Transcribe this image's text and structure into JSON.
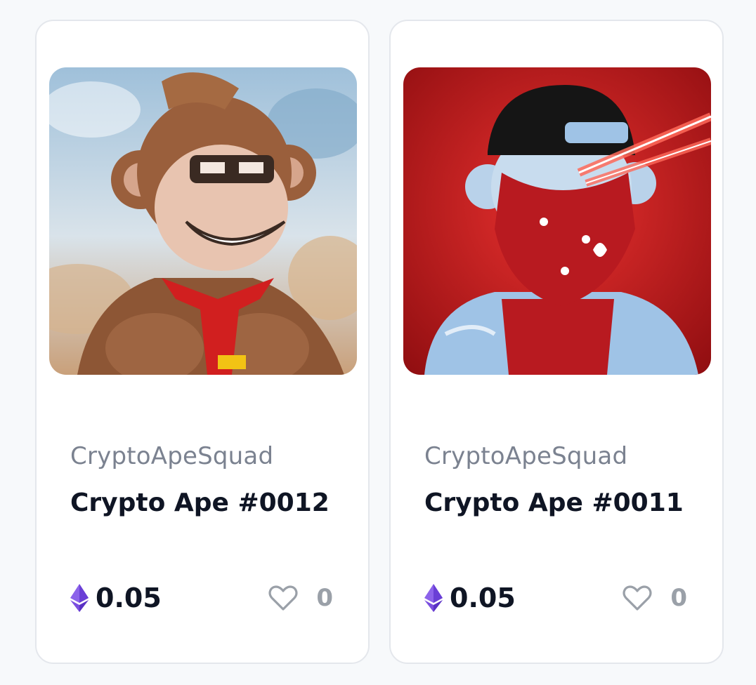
{
  "cards": [
    {
      "image_alt": "Crypto Ape #0012",
      "collection": "CryptoApeSquad",
      "title": "Crypto Ape #0012",
      "price": "0.05",
      "likes": "0",
      "image_colors": {
        "sky": "#a9c6dd",
        "fur": "#9a5f3c",
        "face": "#e8c4b0",
        "tie": "#d11f1f"
      }
    },
    {
      "image_alt": "Crypto Ape #0011",
      "collection": "CryptoApeSquad",
      "title": "Crypto Ape #0011",
      "price": "0.05",
      "likes": "0",
      "image_colors": {
        "bg": "#c8161a",
        "cap": "#151515",
        "bandana": "#b81a20",
        "jacket": "#9fc3e6"
      }
    }
  ],
  "icons": {
    "currency": "ethereum-icon",
    "like": "heart-outline-icon"
  },
  "colors": {
    "eth_purple": "#7b4fe0",
    "text_dark": "#0f1524",
    "text_muted": "#7b8290",
    "border": "#e4e7ec"
  }
}
